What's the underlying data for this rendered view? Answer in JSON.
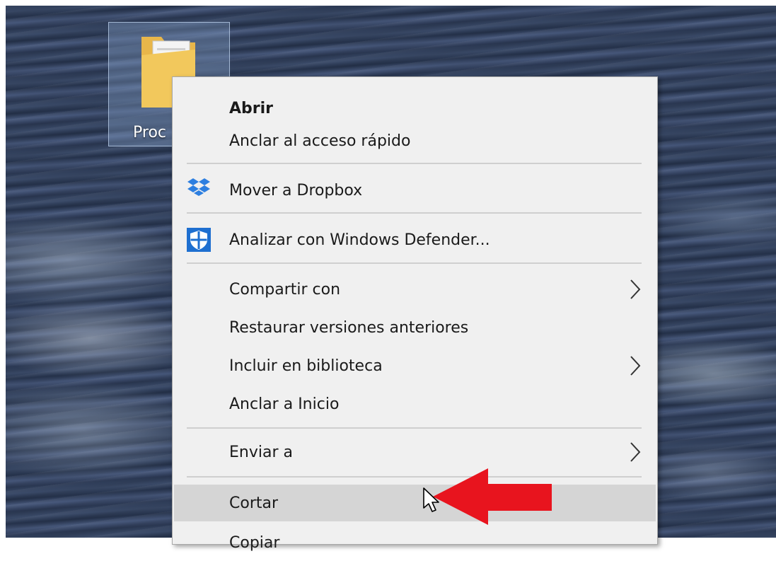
{
  "desktop": {
    "icon_label": "Proc"
  },
  "context_menu": {
    "items": [
      {
        "label": "Abrir",
        "bold": true
      },
      {
        "label": "Anclar al acceso rápido"
      },
      {
        "label": "Mover a Dropbox",
        "icon": "dropbox-icon"
      },
      {
        "label": "Analizar con Windows Defender...",
        "icon": "windows-defender-icon"
      },
      {
        "label": "Compartir con",
        "submenu": true
      },
      {
        "label": "Restaurar versiones anteriores"
      },
      {
        "label": "Incluir en biblioteca",
        "submenu": true
      },
      {
        "label": "Anclar a Inicio"
      },
      {
        "label": "Enviar a",
        "submenu": true
      },
      {
        "label": "Cortar",
        "highlighted": true
      },
      {
        "label": "Copiar"
      }
    ]
  },
  "colors": {
    "menu_background": "#f0f0f0",
    "menu_hover": "#d5d5d5",
    "annotation_arrow": "#e8141e",
    "defender_blue": "#1e6fd0",
    "dropbox_blue": "#2d7fe0"
  }
}
